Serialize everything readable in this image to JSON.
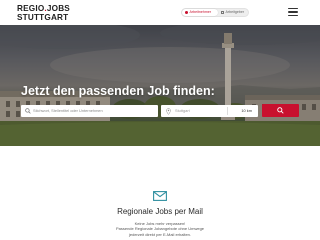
{
  "header": {
    "logo": {
      "part1": "REGIO",
      "part2": "JOBS",
      "part3": "STUTTGART"
    },
    "toggle": {
      "active_label": "Arbeitnehmer",
      "inactive_label": "Arbeitgeber"
    },
    "menu_icon": "hamburger-menu-icon"
  },
  "hero": {
    "title": "Jetzt den passenden Job finden:",
    "search": {
      "placeholder": "Stichwort, Stellentitel oder Unternehmen",
      "icon": "search-icon"
    },
    "location": {
      "placeholder": "Stuttgart",
      "radius": "10 km",
      "icon": "location-pin-icon"
    },
    "search_button_icon": "search-icon"
  },
  "newsletter": {
    "icon": "mail-icon",
    "title": "Regionale Jobs per Mail",
    "lines": [
      "Keine Jobs mehr verpassen!",
      "Passende Regionale Jobangebote ohne Umwege",
      "jederzeit direkt per E-Mail erhalten."
    ]
  },
  "colors": {
    "accent": "#c8102e",
    "text": "#2b2b2b"
  }
}
